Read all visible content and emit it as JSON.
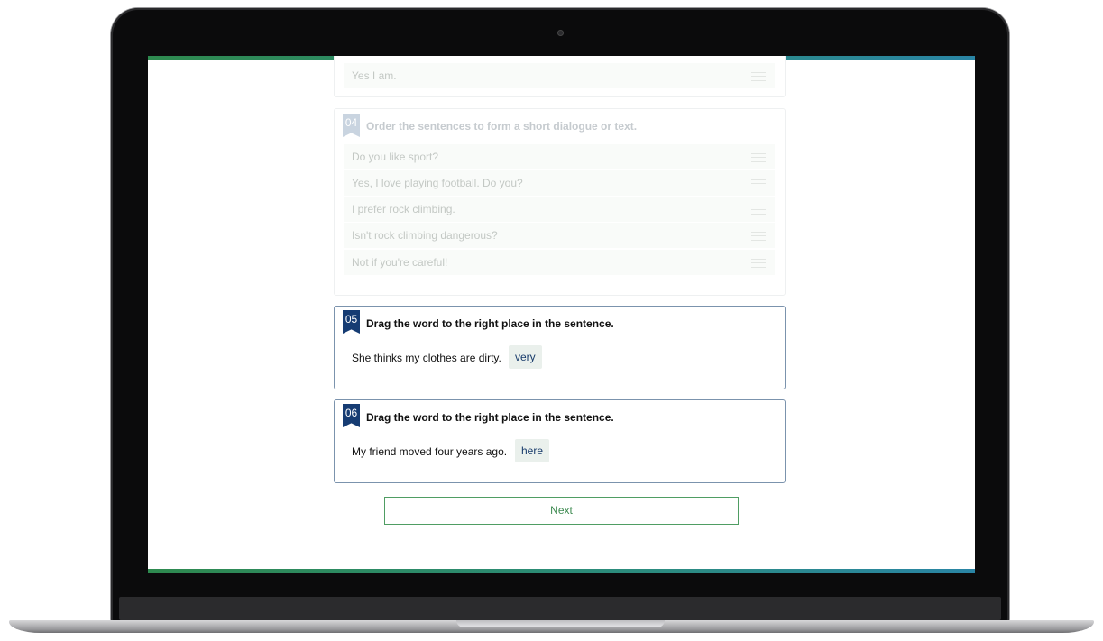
{
  "card_prev": {
    "answer": "Yes I am."
  },
  "q04": {
    "number": "04",
    "title": "Order the sentences to form a short dialogue or text.",
    "items": [
      "Do you like sport?",
      "Yes, I love playing football. Do you?",
      "I prefer rock climbing.",
      "Isn't rock climbing dangerous?",
      "Not if you're careful!"
    ]
  },
  "q05": {
    "number": "05",
    "title": "Drag the word to the right place in the sentence.",
    "sentence": "She thinks my clothes are dirty.",
    "word": "very"
  },
  "q06": {
    "number": "06",
    "title": "Drag the word to the right place in the sentence.",
    "sentence": "My friend moved four years ago.",
    "word": "here"
  },
  "next_label": "Next",
  "colors": {
    "accent_green": "#3d8a50",
    "badge_blue": "#163c73",
    "chip_bg": "#eaf0ec"
  }
}
